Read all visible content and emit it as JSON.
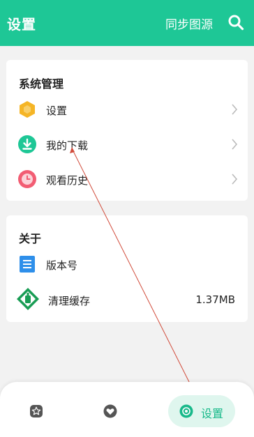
{
  "header": {
    "title": "设置",
    "sync_label": "同步图源",
    "accent_color": "#1ec796"
  },
  "system_section": {
    "title": "系统管理",
    "items": [
      {
        "label": "设置",
        "icon": "hexagon-icon",
        "color": "#f5b526"
      },
      {
        "label": "我的下载",
        "icon": "download-icon",
        "color": "#1ec796"
      },
      {
        "label": "观看历史",
        "icon": "clock-icon",
        "color": "#f25d73"
      }
    ]
  },
  "about_section": {
    "title": "关于",
    "items": [
      {
        "label": "版本号",
        "icon": "document-icon",
        "color": "#2e8fea"
      },
      {
        "label": "清理缓存",
        "icon": "cache-broom-icon",
        "color": "#1a9d55",
        "value": "1.37MB"
      }
    ]
  },
  "bottom_nav": {
    "items": [
      {
        "icon": "star-icon"
      },
      {
        "icon": "heart-icon"
      },
      {
        "icon": "settings-icon",
        "label": "设置",
        "active": true
      }
    ]
  }
}
